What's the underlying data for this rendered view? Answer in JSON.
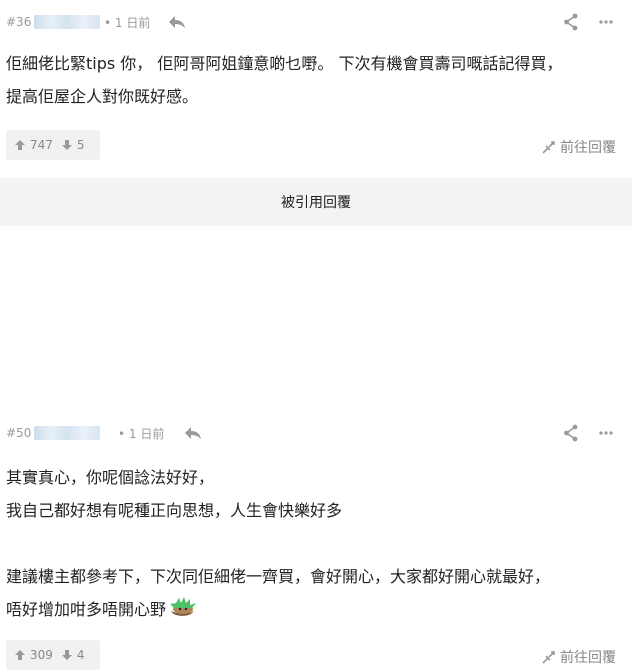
{
  "posts": [
    {
      "number": "#36",
      "separator": "•",
      "time": "1 日前",
      "lines": [
        "佢細佬比緊tips 你， 佢阿哥阿姐鐘意啲乜嘢。 下次有機會買壽司嘅話記得買，",
        "提高佢屋企人對你既好感。"
      ],
      "upvotes": "747",
      "downvotes": "5",
      "goto_label": "前往回覆"
    },
    {
      "number": "#50",
      "separator": "•",
      "time": "1 日前",
      "lines": [
        "其實真心，你呢個諗法好好，",
        "我自己都好想有呢種正向思想，人生會快樂好多",
        "",
        "建議樓主都參考下，下次同佢細佬一齊買，會好開心，大家都好開心就最好，",
        "唔好增加咁多唔開心野"
      ],
      "upvotes": "309",
      "downvotes": "4",
      "goto_label": "前往回覆"
    }
  ],
  "quoted_label": "被引用回覆",
  "icons": {
    "reply": "reply-arrow-icon",
    "share": "share-icon",
    "more": "more-dots-icon",
    "upvote": "thumb-up-arrow-icon",
    "downvote": "thumb-down-arrow-icon",
    "goto": "goto-reply-icon",
    "emoji": "green-haired-emoji-icon"
  },
  "colors": {
    "muted": "#999999",
    "text": "#222222",
    "vote_bg": "#f1f1f1",
    "quoted_bg": "#f3f3f3"
  }
}
